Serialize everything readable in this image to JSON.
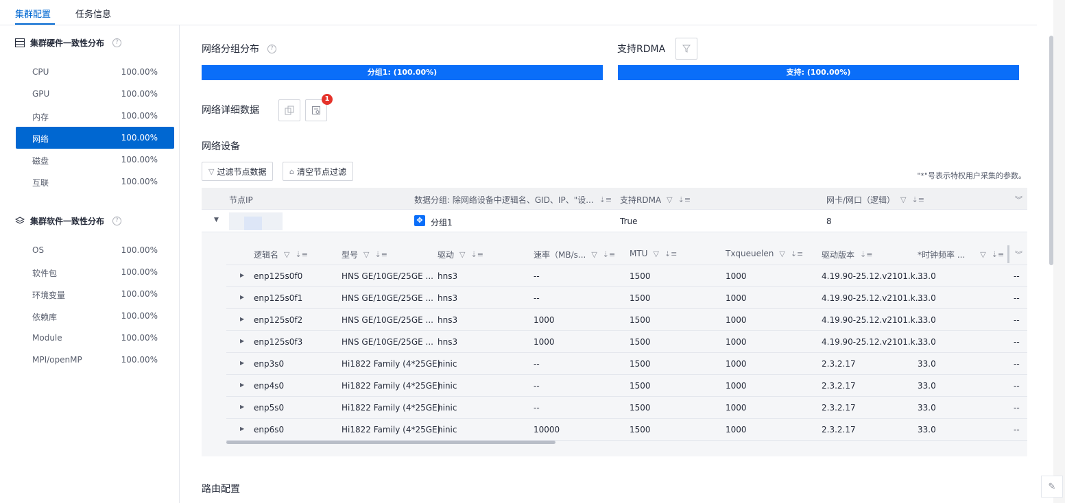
{
  "tabs": [
    {
      "label": "集群配置"
    },
    {
      "label": "任务信息"
    }
  ],
  "hardware": {
    "title": "集群硬件一致性分布",
    "items": [
      {
        "name": "CPU",
        "value": "100.00%"
      },
      {
        "name": "GPU",
        "value": "100.00%"
      },
      {
        "name": "内存",
        "value": "100.00%"
      },
      {
        "name": "网络",
        "value": "100.00%"
      },
      {
        "name": "磁盘",
        "value": "100.00%"
      },
      {
        "name": "互联",
        "value": "100.00%"
      }
    ]
  },
  "software": {
    "title": "集群软件一致性分布",
    "items": [
      {
        "name": "OS",
        "value": "100.00%"
      },
      {
        "name": "软件包",
        "value": "100.00%"
      },
      {
        "name": "环境变量",
        "value": "100.00%"
      },
      {
        "name": "依赖库",
        "value": "100.00%"
      },
      {
        "name": "Module",
        "value": "100.00%"
      },
      {
        "name": "MPI/openMP",
        "value": "100.00%"
      }
    ]
  },
  "group_dist": {
    "title": "网络分组分布",
    "bar_label": "分组1: (100.00%)",
    "percent": 100
  },
  "rdma_dist": {
    "title": "支持RDMA",
    "bar_label": "支持: (100.00%)",
    "percent": 100
  },
  "detail": {
    "title": "网络详细数据",
    "badge": "1"
  },
  "devices": {
    "title": "网络设备",
    "filter_btn": "过滤节点数据",
    "clear_btn": "清空节点过滤",
    "note": "\"*\"号表示特权用户采集的参数。",
    "columns": [
      "节点IP",
      "数据分组: 除网络设备中逻辑名、GID、IP、\"设...",
      "支持RDMA",
      "网卡/网口（逻辑）"
    ],
    "row": {
      "ip": "",
      "group": "分组1",
      "rdma": "True",
      "nic": "8"
    }
  },
  "inner": {
    "columns": [
      "逻辑名",
      "型号",
      "驱动",
      "速率（MB/s...",
      "MTU",
      "Txqueuelen",
      "驱动版本",
      "*时钟频率 ..."
    ],
    "rows": [
      [
        "enp125s0f0",
        "HNS GE/10GE/25GE ...",
        "hns3",
        "--",
        "1500",
        "1000",
        "4.19.90-25.12.v2101.k...",
        "33.0",
        "--"
      ],
      [
        "enp125s0f1",
        "HNS GE/10GE/25GE ...",
        "hns3",
        "--",
        "1500",
        "1000",
        "4.19.90-25.12.v2101.k...",
        "33.0",
        "--"
      ],
      [
        "enp125s0f2",
        "HNS GE/10GE/25GE ...",
        "hns3",
        "1000",
        "1500",
        "1000",
        "4.19.90-25.12.v2101.k...",
        "33.0",
        "--"
      ],
      [
        "enp125s0f3",
        "HNS GE/10GE/25GE ...",
        "hns3",
        "1000",
        "1500",
        "1000",
        "4.19.90-25.12.v2101.k...",
        "33.0",
        "--"
      ],
      [
        "enp3s0",
        "Hi1822 Family (4*25GE)",
        "hinic",
        "--",
        "1500",
        "1000",
        "2.3.2.17",
        "33.0",
        "--"
      ],
      [
        "enp4s0",
        "Hi1822 Family (4*25GE)",
        "hinic",
        "--",
        "1500",
        "1000",
        "2.3.2.17",
        "33.0",
        "--"
      ],
      [
        "enp5s0",
        "Hi1822 Family (4*25GE)",
        "hinic",
        "--",
        "1500",
        "1000",
        "2.3.2.17",
        "33.0",
        "--"
      ],
      [
        "enp6s0",
        "Hi1822 Family (4*25GE)",
        "hinic",
        "10000",
        "1500",
        "1000",
        "2.3.2.17",
        "33.0",
        "--"
      ]
    ]
  },
  "route": {
    "title": "路由配置"
  }
}
